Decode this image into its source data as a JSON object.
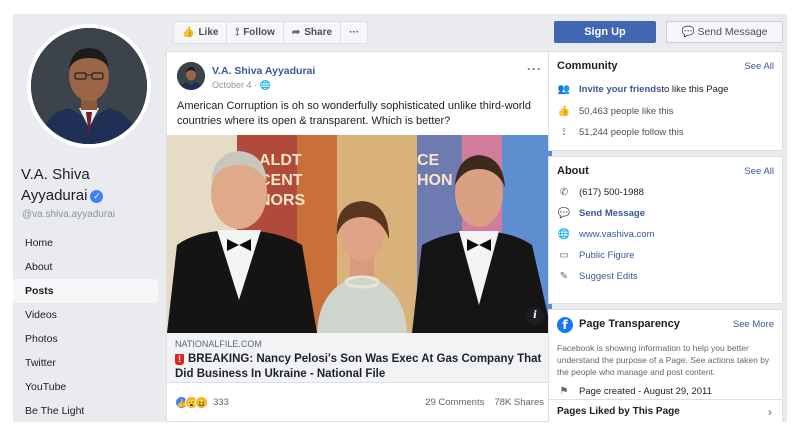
{
  "left": {
    "name_line1": "V.A. Shiva",
    "name_line2": "Ayyadurai",
    "handle": "@va.shiva.ayyadurai",
    "nav": [
      "Home",
      "About",
      "Posts",
      "Videos",
      "Photos",
      "Twitter",
      "YouTube",
      "Be The Light"
    ],
    "active_nav": "Posts"
  },
  "toolbar": {
    "like": "Like",
    "follow": "Follow",
    "share": "Share",
    "more": "···"
  },
  "post": {
    "author": "V.A. Shiva Ayyadurai",
    "date": "October 4 ·",
    "text": "American Corruption is oh so wonderfully sophisticated unlike third-world countries where its open & transparent. Which is better?",
    "link_domain": "NATIONALFILE.COM",
    "link_title": "BREAKING: Nancy Pelosi's Son Was Exec At Gas Company That Did Business In Ukraine - National File",
    "reaction_count": "333",
    "comments": "29 Comments",
    "shares": "78K Shares",
    "image_sign_left": "ALDT\nCENT\nNORS",
    "image_sign_right": "CE\nHON"
  },
  "actions": {
    "signup": "Sign Up",
    "send_message": "Send Message"
  },
  "community": {
    "title": "Community",
    "see_all": "See All",
    "invite_link": "Invite your friends",
    "invite_rest": " to like this Page",
    "likes": "50,463 people like this",
    "follows": "51,244 people follow this"
  },
  "about": {
    "title": "About",
    "see_all": "See All",
    "phone": "(617) 500-1988",
    "send_message": "Send Message",
    "website": "www.vashiva.com",
    "category": "Public Figure",
    "suggest": "Suggest Edits"
  },
  "transparency": {
    "title": "Page Transparency",
    "see_more": "See More",
    "desc": "Facebook is showing information to help you better understand the purpose of a Page. See actions taken by the people who manage and post content.",
    "created": "Page created - August 29, 2011"
  },
  "liked_pages": {
    "title": "Pages Liked by This Page"
  },
  "colors": {
    "fb_blue": "#4267b2",
    "link": "#385898",
    "bg": "#e9ebee"
  }
}
